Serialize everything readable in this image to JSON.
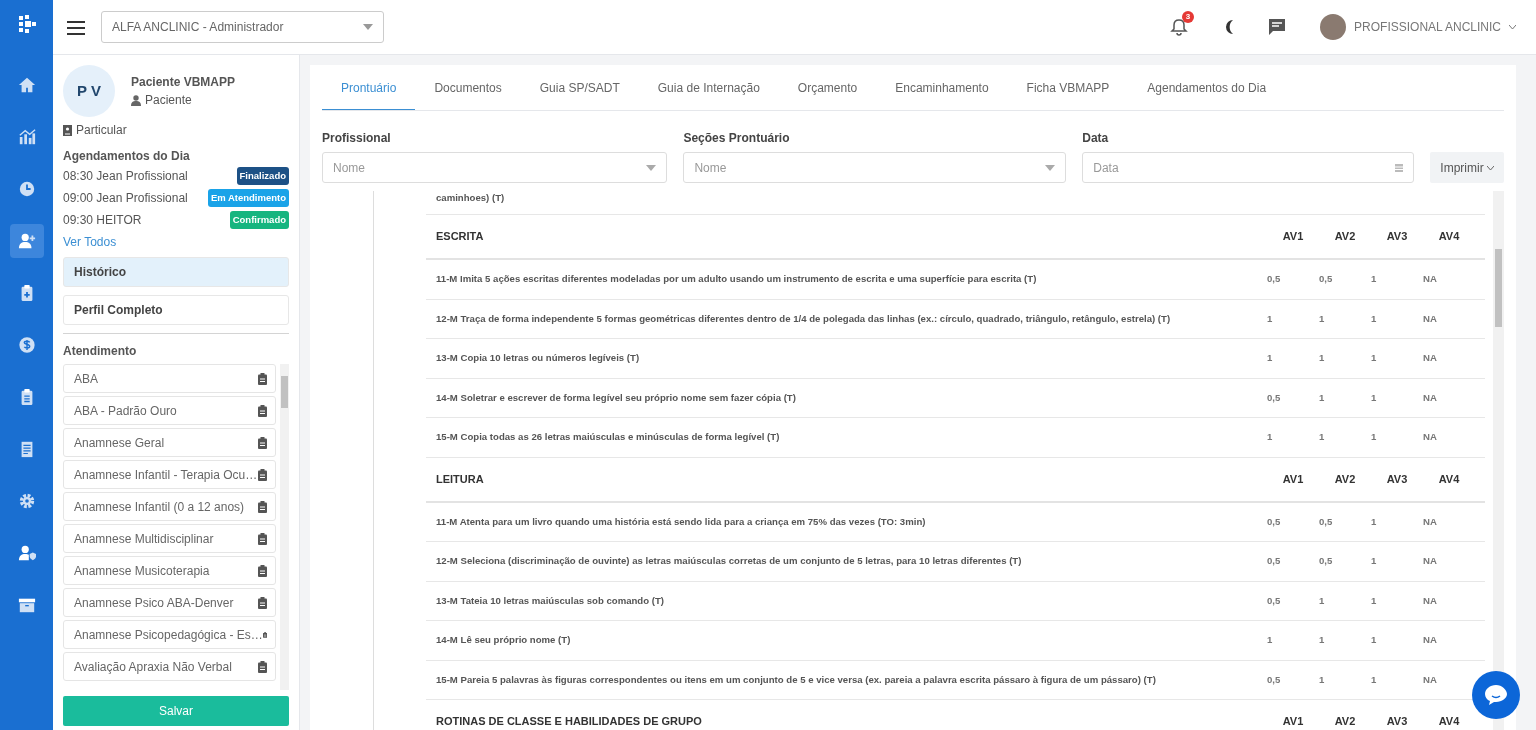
{
  "topbar": {
    "clinic_select": "ALFA ANCLINIC - Administrador",
    "notification_count": "3",
    "user_name": "PROFISSIONAL ANCLINIC"
  },
  "nav_items": [
    {
      "kind": "home",
      "selected": false
    },
    {
      "kind": "chart",
      "selected": false
    },
    {
      "kind": "clock",
      "selected": false
    },
    {
      "kind": "user-plus",
      "selected": true
    },
    {
      "kind": "clipboard-plus",
      "selected": false
    },
    {
      "kind": "dollar",
      "selected": false
    },
    {
      "kind": "clipboard",
      "selected": false
    },
    {
      "kind": "document",
      "selected": false
    },
    {
      "kind": "gear",
      "selected": false
    },
    {
      "kind": "user-shield",
      "selected": false
    },
    {
      "kind": "archive",
      "selected": false
    }
  ],
  "patient": {
    "initials": "P V",
    "name": "Paciente VBMAPP",
    "role": "Paciente",
    "plan": "Particular",
    "appointments_title": "Agendamentos do Dia",
    "appointments": [
      {
        "text": "08:30 Jean Profissional",
        "status": "Finalizado",
        "color": "#1d5186"
      },
      {
        "text": "09:00 Jean Profissional",
        "status": "Em Atendimento",
        "color": "#1aa3e8"
      },
      {
        "text": "09:30 HEITOR",
        "status": "Confirmado",
        "color": "#16b57f"
      }
    ],
    "see_all": "Ver Todos",
    "menu": [
      {
        "label": "Histórico",
        "selected": true
      },
      {
        "label": "Perfil Completo",
        "selected": false
      }
    ],
    "attendance_title": "Atendimento",
    "attendance": [
      "ABA",
      "ABA - Padrão Ouro",
      "Anamnese Geral",
      "Anamnese Infantil - Terapia Ocu…",
      "Anamnese Infantil (0 a 12 anos)",
      "Anamnese Multidisciplinar",
      "Anamnese Musicoterapia",
      "Anamnese Psico ABA-Denver",
      "Anamnese Psicopedagógica - Es…",
      "Avaliação Apraxia Não Verbal"
    ],
    "save": "Salvar"
  },
  "tabs": [
    {
      "label": "Prontuário",
      "selected": true
    },
    {
      "label": "Documentos",
      "selected": false
    },
    {
      "label": "Guia SP/SADT",
      "selected": false
    },
    {
      "label": "Guia de Internação",
      "selected": false
    },
    {
      "label": "Orçamento",
      "selected": false
    },
    {
      "label": "Encaminhamento",
      "selected": false
    },
    {
      "label": "Ficha VBMAPP",
      "selected": false
    },
    {
      "label": "Agendamentos do Dia",
      "selected": false
    }
  ],
  "filters": [
    {
      "kind": "select",
      "label": "Profissional",
      "placeholder": "Nome"
    },
    {
      "kind": "select",
      "label": "Seções Prontuário",
      "placeholder": "Nome"
    },
    {
      "kind": "date",
      "label": "Data",
      "placeholder": "Data"
    }
  ],
  "print_button": "Imprimir",
  "partial_row": "caminhoes) (T)",
  "sections": [
    {
      "title": "ESCRITA",
      "columns": [
        "AV1",
        "AV2",
        "AV3",
        "AV4"
      ],
      "rows": [
        {
          "item": "11-M Imita 5 ações escritas diferentes modeladas por um adulto usando um instrumento de escrita e uma superfície para escrita (T)",
          "scores": [
            "0,5",
            "0,5",
            "1",
            "NA"
          ]
        },
        {
          "item": "12-M Traça de forma independente 5 formas geométricas diferentes dentro de 1/4 de polegada das linhas (ex.: círculo, quadrado, triângulo, retângulo, estrela) (T)",
          "scores": [
            "1",
            "1",
            "1",
            "NA"
          ]
        },
        {
          "item": "13-M Copia 10 letras ou números legíveis (T)",
          "scores": [
            "1",
            "1",
            "1",
            "NA"
          ]
        },
        {
          "item": "14-M Soletrar e escrever de forma legível seu próprio nome sem fazer cópia (T)",
          "scores": [
            "0,5",
            "1",
            "1",
            "NA"
          ]
        },
        {
          "item": "15-M Copia todas as 26 letras maiúsculas e minúsculas de forma legível (T)",
          "scores": [
            "1",
            "1",
            "1",
            "NA"
          ]
        }
      ]
    },
    {
      "title": "LEITURA",
      "columns": [
        "AV1",
        "AV2",
        "AV3",
        "AV4"
      ],
      "rows": [
        {
          "item": "11-M Atenta para um livro quando uma história está sendo lida para a criança em 75% das vezes (TO: 3min)",
          "scores": [
            "0,5",
            "0,5",
            "1",
            "NA"
          ]
        },
        {
          "item": "12-M Seleciona (discriminação de ouvinte) as letras maiúsculas corretas de um conjunto de 5 letras, para 10 letras diferentes (T)",
          "scores": [
            "0,5",
            "0,5",
            "1",
            "NA"
          ]
        },
        {
          "item": "13-M Tateia 10 letras maiúsculas sob comando (T)",
          "scores": [
            "0,5",
            "1",
            "1",
            "NA"
          ]
        },
        {
          "item": "14-M Lê seu próprio nome (T)",
          "scores": [
            "1",
            "1",
            "1",
            "NA"
          ]
        },
        {
          "item": "15-M Pareia 5 palavras às figuras correspondentes ou itens em um conjunto de 5 e vice versa (ex. pareia a palavra escrita pássaro à figura de um pássaro) (T)",
          "scores": [
            "0,5",
            "1",
            "1",
            "NA"
          ]
        }
      ]
    },
    {
      "title": "ROTINAS DE CLASSE E HABILIDADES DE GRUPO",
      "columns": [
        "AV1",
        "AV2",
        "AV3",
        "AV4"
      ]
    }
  ]
}
